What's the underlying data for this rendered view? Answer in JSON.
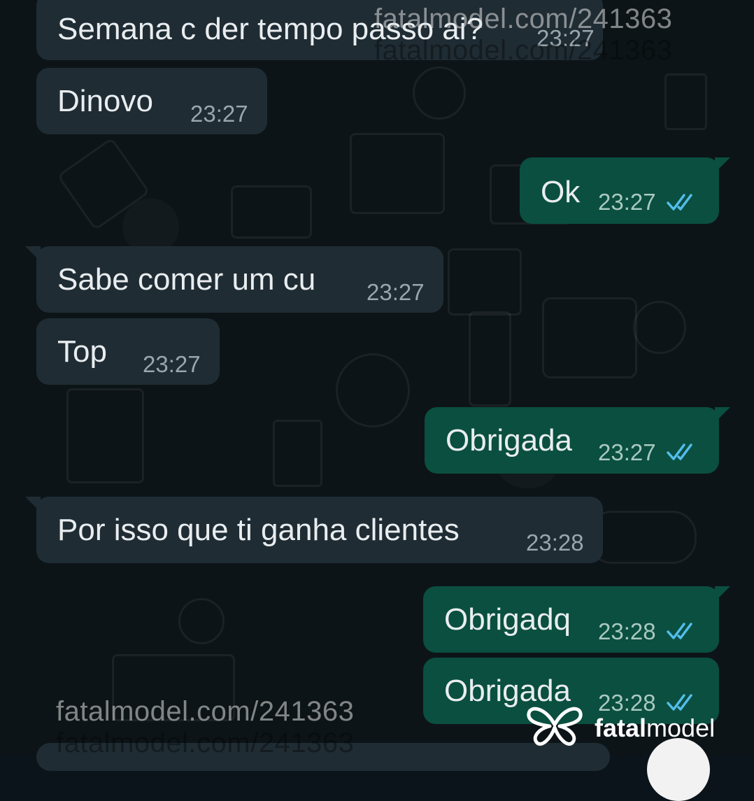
{
  "messages": [
    {
      "dir": "in",
      "text": "Semana c der tempo passo ai?",
      "time": "23:27"
    },
    {
      "dir": "in",
      "text": "Dinovo",
      "time": "23:27"
    },
    {
      "dir": "out",
      "text": "Ok",
      "time": "23:27",
      "status": "read"
    },
    {
      "dir": "in",
      "text": "Sabe comer um cu",
      "time": "23:27"
    },
    {
      "dir": "in",
      "text": "Top",
      "time": "23:27"
    },
    {
      "dir": "out",
      "text": "Obrigada",
      "time": "23:27",
      "status": "read"
    },
    {
      "dir": "in",
      "text": "Por isso que ti ganha clientes",
      "time": "23:28"
    },
    {
      "dir": "out",
      "text": "Obrigadq",
      "time": "23:28",
      "status": "read"
    },
    {
      "dir": "out",
      "text": "Obrigada",
      "time": "23:28",
      "status": "read"
    }
  ],
  "watermark": {
    "text": "fatalmodel.com/241363"
  },
  "brand": {
    "logo_icon": "fatalmodel-butterfly-icon",
    "name_bold": "fatal",
    "name_regular": "model"
  },
  "colors": {
    "background": "#0b141a",
    "incoming_bubble": "#1f2c34",
    "outgoing_bubble": "#0a4f40",
    "read_ticks": "#53bdeb",
    "text": "#e9edef"
  },
  "icons": {
    "read_status": "double-check-icon"
  }
}
